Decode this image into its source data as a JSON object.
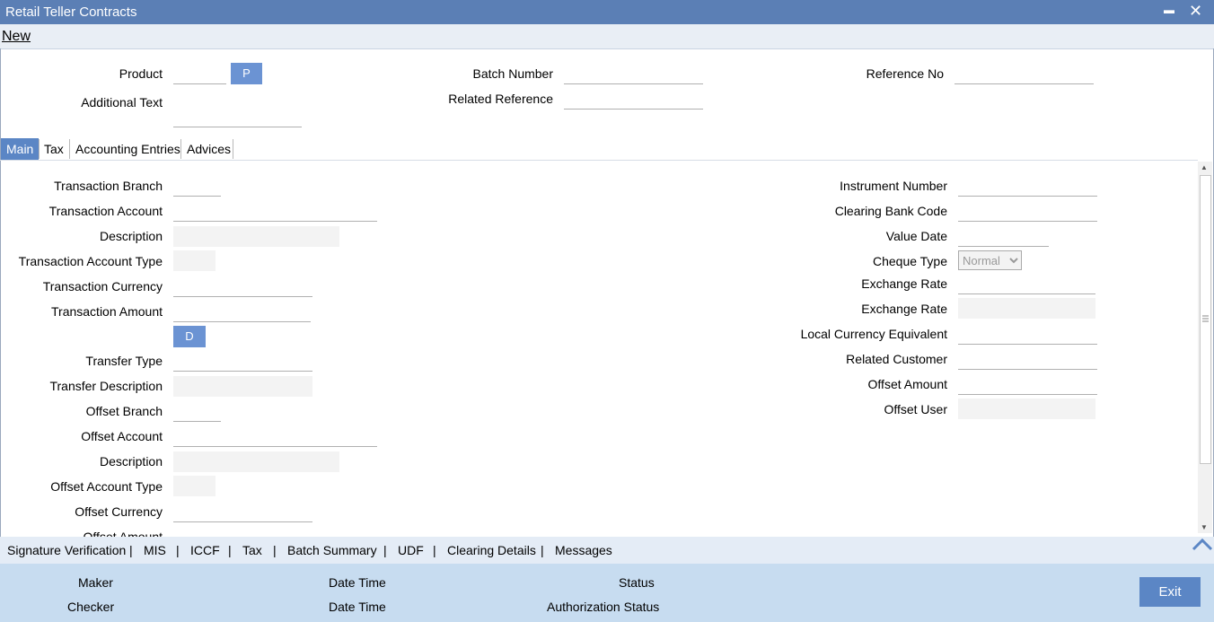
{
  "window": {
    "title": "Retail Teller Contracts",
    "minimize": "▬",
    "close": "✕"
  },
  "menu": {
    "new": "New"
  },
  "header": {
    "product_label": "Product",
    "product_button": "P",
    "additional_text_label": "Additional Text",
    "batch_number_label": "Batch Number",
    "related_reference_label": "Related Reference",
    "reference_no_label": "Reference No"
  },
  "tabs": [
    {
      "label": "Main"
    },
    {
      "label": "Tax"
    },
    {
      "label": "Accounting Entries"
    },
    {
      "label": "Advices"
    }
  ],
  "main": {
    "left": {
      "transaction_branch": "Transaction Branch",
      "transaction_account": "Transaction Account",
      "description": "Description",
      "transaction_account_type": "Transaction Account Type",
      "transaction_currency": "Transaction Currency",
      "transaction_amount": "Transaction Amount",
      "d_button": "D",
      "transfer_type": "Transfer Type",
      "transfer_description": "Transfer Description",
      "offset_branch": "Offset Branch",
      "offset_account": "Offset Account",
      "offset_description": "Description",
      "offset_account_type": "Offset Account Type",
      "offset_currency": "Offset Currency",
      "offset_amount_partial": "Offset Amount"
    },
    "right": {
      "instrument_number": "Instrument Number",
      "clearing_bank_code": "Clearing Bank Code",
      "value_date": "Value Date",
      "cheque_type": "Cheque Type",
      "cheque_type_value": "Normal",
      "exchange_rate_1": "Exchange Rate",
      "exchange_rate_2": "Exchange Rate",
      "local_currency_equivalent": "Local Currency Equivalent",
      "related_customer": "Related Customer",
      "offset_amount": "Offset Amount",
      "offset_user": "Offset User"
    }
  },
  "links": {
    "signature_verification": "Signature Verification",
    "mis": "MIS",
    "iccf": "ICCF",
    "tax": "Tax",
    "batch_summary": "Batch Summary",
    "udf": "UDF",
    "clearing_details": "Clearing Details",
    "messages": "Messages",
    "separator": "|"
  },
  "footer": {
    "maker": "Maker",
    "checker": "Checker",
    "date_time_1": "Date Time",
    "date_time_2": "Date Time",
    "status": "Status",
    "authorization_status": "Authorization Status",
    "exit": "Exit"
  }
}
